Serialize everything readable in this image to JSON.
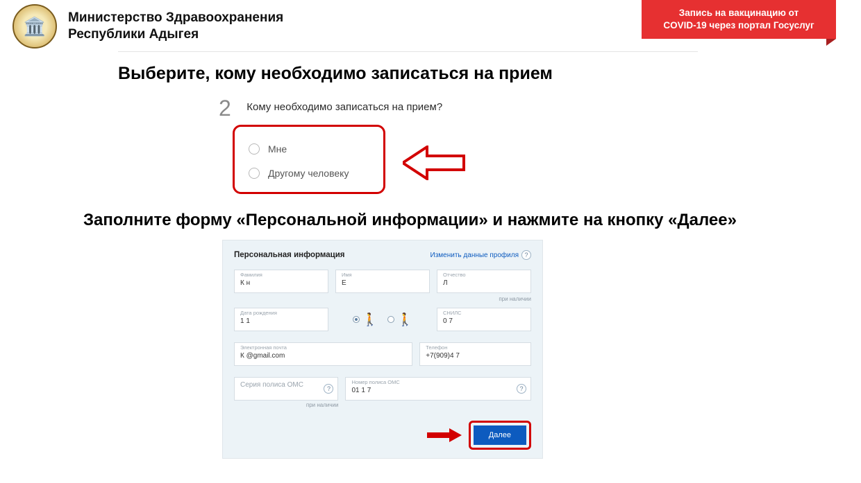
{
  "header": {
    "ministry_line1": "Министерство Здравоохранения",
    "ministry_line2": "Республики Адыгея",
    "banner_line1": "Запись на вакцинацию от",
    "banner_line2": "COVID-19 через портал Госуслуг"
  },
  "heading1": "Выберите, кому необходимо записаться на прием",
  "step2": {
    "number": "2",
    "question": "Кому необходимо записаться на прием?",
    "options": [
      "Мне",
      "Другому человеку"
    ]
  },
  "heading2": "Заполните форму «Персональной информации» и нажмите на кнопку «Далее»",
  "form": {
    "title": "Персональная информация",
    "profile_link": "Изменить данные профиля",
    "note": "при наличии",
    "fields": {
      "lastname": {
        "label": "Фамилия",
        "value": "К        н"
      },
      "firstname": {
        "label": "Имя",
        "value": "Е"
      },
      "patronymic": {
        "label": "Отчество",
        "value": "Л"
      },
      "dob": {
        "label": "Дата рождения",
        "value": "1         1"
      },
      "snils": {
        "label": "СНИЛС",
        "value": "0                 7"
      },
      "email": {
        "label": "Электронная почта",
        "value": "К          @gmail.com"
      },
      "phone": {
        "label": "Телефон",
        "value": "+7(909)4       7"
      },
      "oms_series": {
        "label": "Серия полиса ОМС",
        "value": "Серия полиса ОМС"
      },
      "oms_number": {
        "label": "Номер полиса ОМС",
        "value": "01            1              7"
      }
    },
    "next_button": "Далее"
  }
}
